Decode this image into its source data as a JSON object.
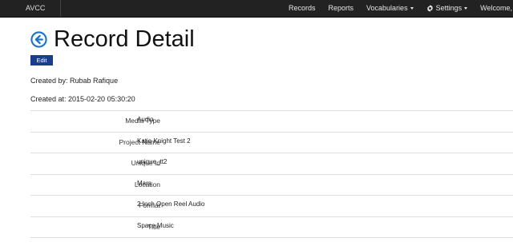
{
  "navbar": {
    "brand": "AVCC",
    "items": [
      {
        "label": "Records"
      },
      {
        "label": "Reports"
      },
      {
        "label": "Vocabularies"
      },
      {
        "label": "Settings"
      },
      {
        "label": "Welcome, Josh R"
      }
    ]
  },
  "page": {
    "title": "Record Detail",
    "edit_label": "Edit",
    "created_by": "Created by: Rubab Rafique",
    "created_at": "Created at: 2015-02-20 05:30:20"
  },
  "details": [
    {
      "label": "Media Type",
      "value": "Audio"
    },
    {
      "label": "Project Name",
      "value": "Katie Knight Test 2"
    },
    {
      "label": "Unique Id",
      "value": "unique_tt2"
    },
    {
      "label": "Location",
      "value": "Mars"
    },
    {
      "label": "Format",
      "value": "2 Inch Open Reel Audio"
    },
    {
      "label": "Title",
      "value": "Space Music"
    }
  ],
  "colors": {
    "navbar_bg": "#222222",
    "accent_blue": "#1c3c8c",
    "back_icon": "#1a73c9"
  },
  "icons": {
    "back": "arrow-circle-left-icon",
    "settings": "gear-icon",
    "dropdown": "caret-down-icon"
  }
}
